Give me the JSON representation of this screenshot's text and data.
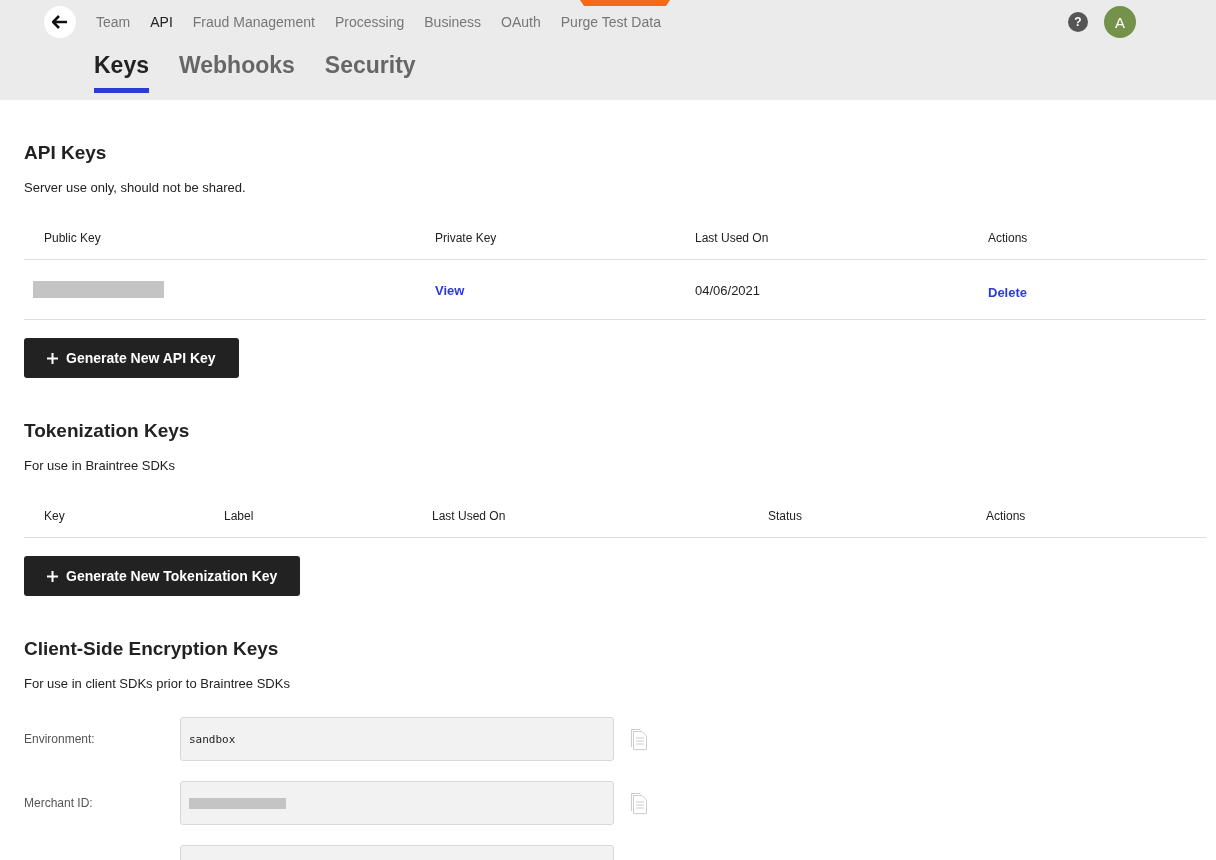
{
  "nav": {
    "items": [
      {
        "label": "Team",
        "selected": false
      },
      {
        "label": "API",
        "selected": true
      },
      {
        "label": "Fraud Management",
        "selected": false
      },
      {
        "label": "Processing",
        "selected": false
      },
      {
        "label": "Business",
        "selected": false
      },
      {
        "label": "OAuth",
        "selected": false
      },
      {
        "label": "Purge Test Data",
        "selected": false
      }
    ],
    "help": "?",
    "avatar": "A"
  },
  "tabs": [
    {
      "label": "Keys",
      "selected": true
    },
    {
      "label": "Webhooks",
      "selected": false
    },
    {
      "label": "Security",
      "selected": false
    }
  ],
  "api_keys": {
    "title": "API Keys",
    "description": "Server use only, should not be shared.",
    "columns": [
      "Public Key",
      "Private Key",
      "Last Used On",
      "Actions"
    ],
    "rows": [
      {
        "private_key": "View",
        "last_used": "04/06/2021",
        "action": "Delete"
      }
    ],
    "button": "Generate New API Key"
  },
  "tokenization_keys": {
    "title": "Tokenization Keys",
    "description": "For use in Braintree SDKs",
    "columns": [
      "Key",
      "Label",
      "Last Used On",
      "Status",
      "Actions"
    ],
    "button": "Generate New Tokenization Key"
  },
  "cse_keys": {
    "title": "Client-Side Encryption Keys",
    "description": "For use in client SDKs prior to Braintree SDKs",
    "fields": [
      {
        "label": "Environment:",
        "value": "sandbox"
      },
      {
        "label": "Merchant ID:"
      }
    ]
  }
}
